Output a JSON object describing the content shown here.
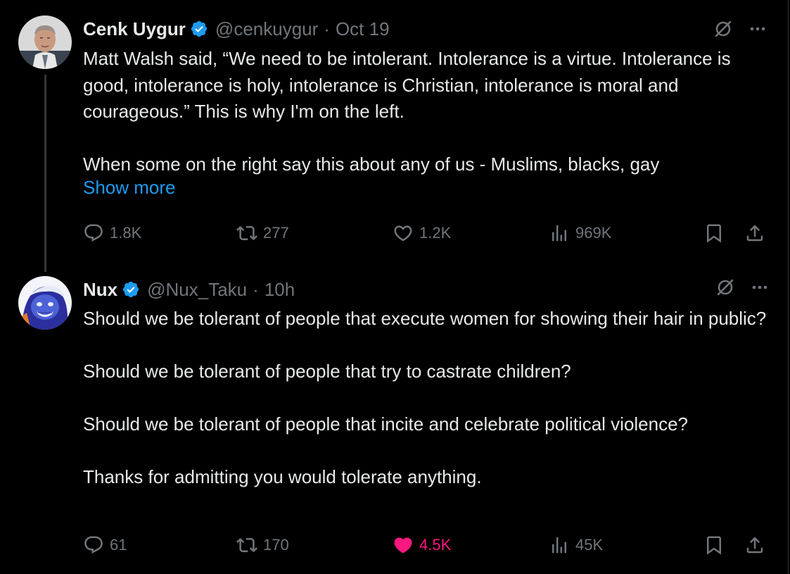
{
  "tweets": [
    {
      "author": {
        "name": "Cenk Uygur",
        "handle": "@cenkuygur",
        "verified": true
      },
      "separator": "·",
      "time": "Oct 19",
      "text": "Matt Walsh said, “We need to be intolerant. Intolerance is a virtue. Intolerance is good, intolerance is holy, intolerance is Christian, intolerance is moral and courageous.” This is why I'm on the left.\n\nWhen some on the right say this about any of us - Muslims, blacks, gay",
      "show_more_label": "Show more",
      "stats": {
        "replies": "1.8K",
        "reposts": "277",
        "likes": "1.2K",
        "views": "969K"
      },
      "liked": false
    },
    {
      "author": {
        "name": "Nux",
        "handle": "@Nux_Taku",
        "verified": true
      },
      "separator": "·",
      "time": "10h",
      "text": "Should we be tolerant of people that execute women for showing their hair in public?\n\nShould we be tolerant of people that try to castrate children?\n\nShould we be tolerant of people that incite and celebrate political violence?\n\nThanks for admitting you would tolerate anything.",
      "stats": {
        "replies": "61",
        "reposts": "170",
        "likes": "4.5K",
        "views": "45K"
      },
      "liked": true
    }
  ],
  "colors": {
    "background": "#000000",
    "text_primary": "#e7e9ea",
    "text_secondary": "#71767b",
    "link": "#1d9bf0",
    "verified": "#1d9bf0",
    "like_active": "#f91880",
    "thread_line": "#333639"
  },
  "icons": {
    "verified": "verified-badge-icon",
    "grok": "grok-icon",
    "more": "more-options-icon",
    "reply": "reply-icon",
    "repost": "repost-icon",
    "like": "heart-icon",
    "views": "views-icon",
    "bookmark": "bookmark-icon",
    "share": "share-icon"
  }
}
